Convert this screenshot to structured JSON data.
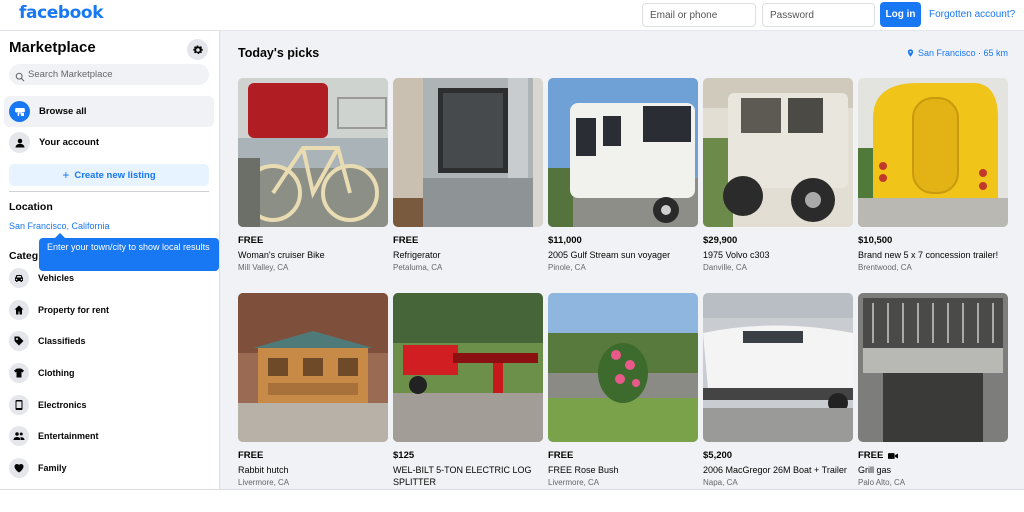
{
  "header": {
    "logo": "facebook",
    "email_placeholder": "Email or phone",
    "password_placeholder": "Password",
    "login_label": "Log in",
    "forgot_label": "Forgotten account?",
    "brand_color": "#1877f2"
  },
  "sidebar": {
    "title": "Marketplace",
    "settings_icon": "gear-icon",
    "search_placeholder": "Search Marketplace",
    "nav": [
      {
        "label": "Browse all",
        "icon": "storefront-icon",
        "active": true
      },
      {
        "label": "Your account",
        "icon": "person-icon",
        "active": false
      }
    ],
    "create_label": "Create new listing",
    "location_heading": "Location",
    "location_value": "San Francisco, California",
    "tooltip": "Enter your town/city to show local results",
    "categories_heading": "Categ",
    "categories": [
      {
        "label": "Vehicles",
        "icon": "car-icon"
      },
      {
        "label": "Property for rent",
        "icon": "house-icon"
      },
      {
        "label": "Classifieds",
        "icon": "tag-icon"
      },
      {
        "label": "Clothing",
        "icon": "shirt-icon"
      },
      {
        "label": "Electronics",
        "icon": "phone-icon"
      },
      {
        "label": "Entertainment",
        "icon": "people-icon"
      },
      {
        "label": "Family",
        "icon": "heart-icon"
      }
    ]
  },
  "main": {
    "title": "Today's picks",
    "location_pill": "San Francisco · 65 km",
    "listings": [
      {
        "price": "FREE",
        "title": "Woman's cruiser Bike",
        "location": "Mill Valley, CA"
      },
      {
        "price": "FREE",
        "title": "Refrigerator",
        "location": "Petaluma, CA"
      },
      {
        "price": "$11,000",
        "title": "2005 Gulf Stream sun voyager",
        "location": "Pinole, CA"
      },
      {
        "price": "$29,900",
        "title": "1975 Volvo c303",
        "location": "Danville, CA"
      },
      {
        "price": "$10,500",
        "title": "Brand new 5 x 7 concession trailer!",
        "location": "Brentwood, CA"
      },
      {
        "price": "FREE",
        "title": "Rabbit hutch",
        "location": "Livermore, CA"
      },
      {
        "price": "$125",
        "title": "WEL-BILT 5-TON ELECTRIC LOG SPLITTER",
        "location": ""
      },
      {
        "price": "FREE",
        "title": "FREE Rose Bush",
        "location": "Livermore, CA"
      },
      {
        "price": "$5,200",
        "title": "2006 MacGregor 26M Boat + Trailer",
        "location": "Napa, CA"
      },
      {
        "price": "FREE",
        "title": "Grill gas",
        "location": "Palo Alto, CA",
        "video_badge": true
      }
    ]
  }
}
